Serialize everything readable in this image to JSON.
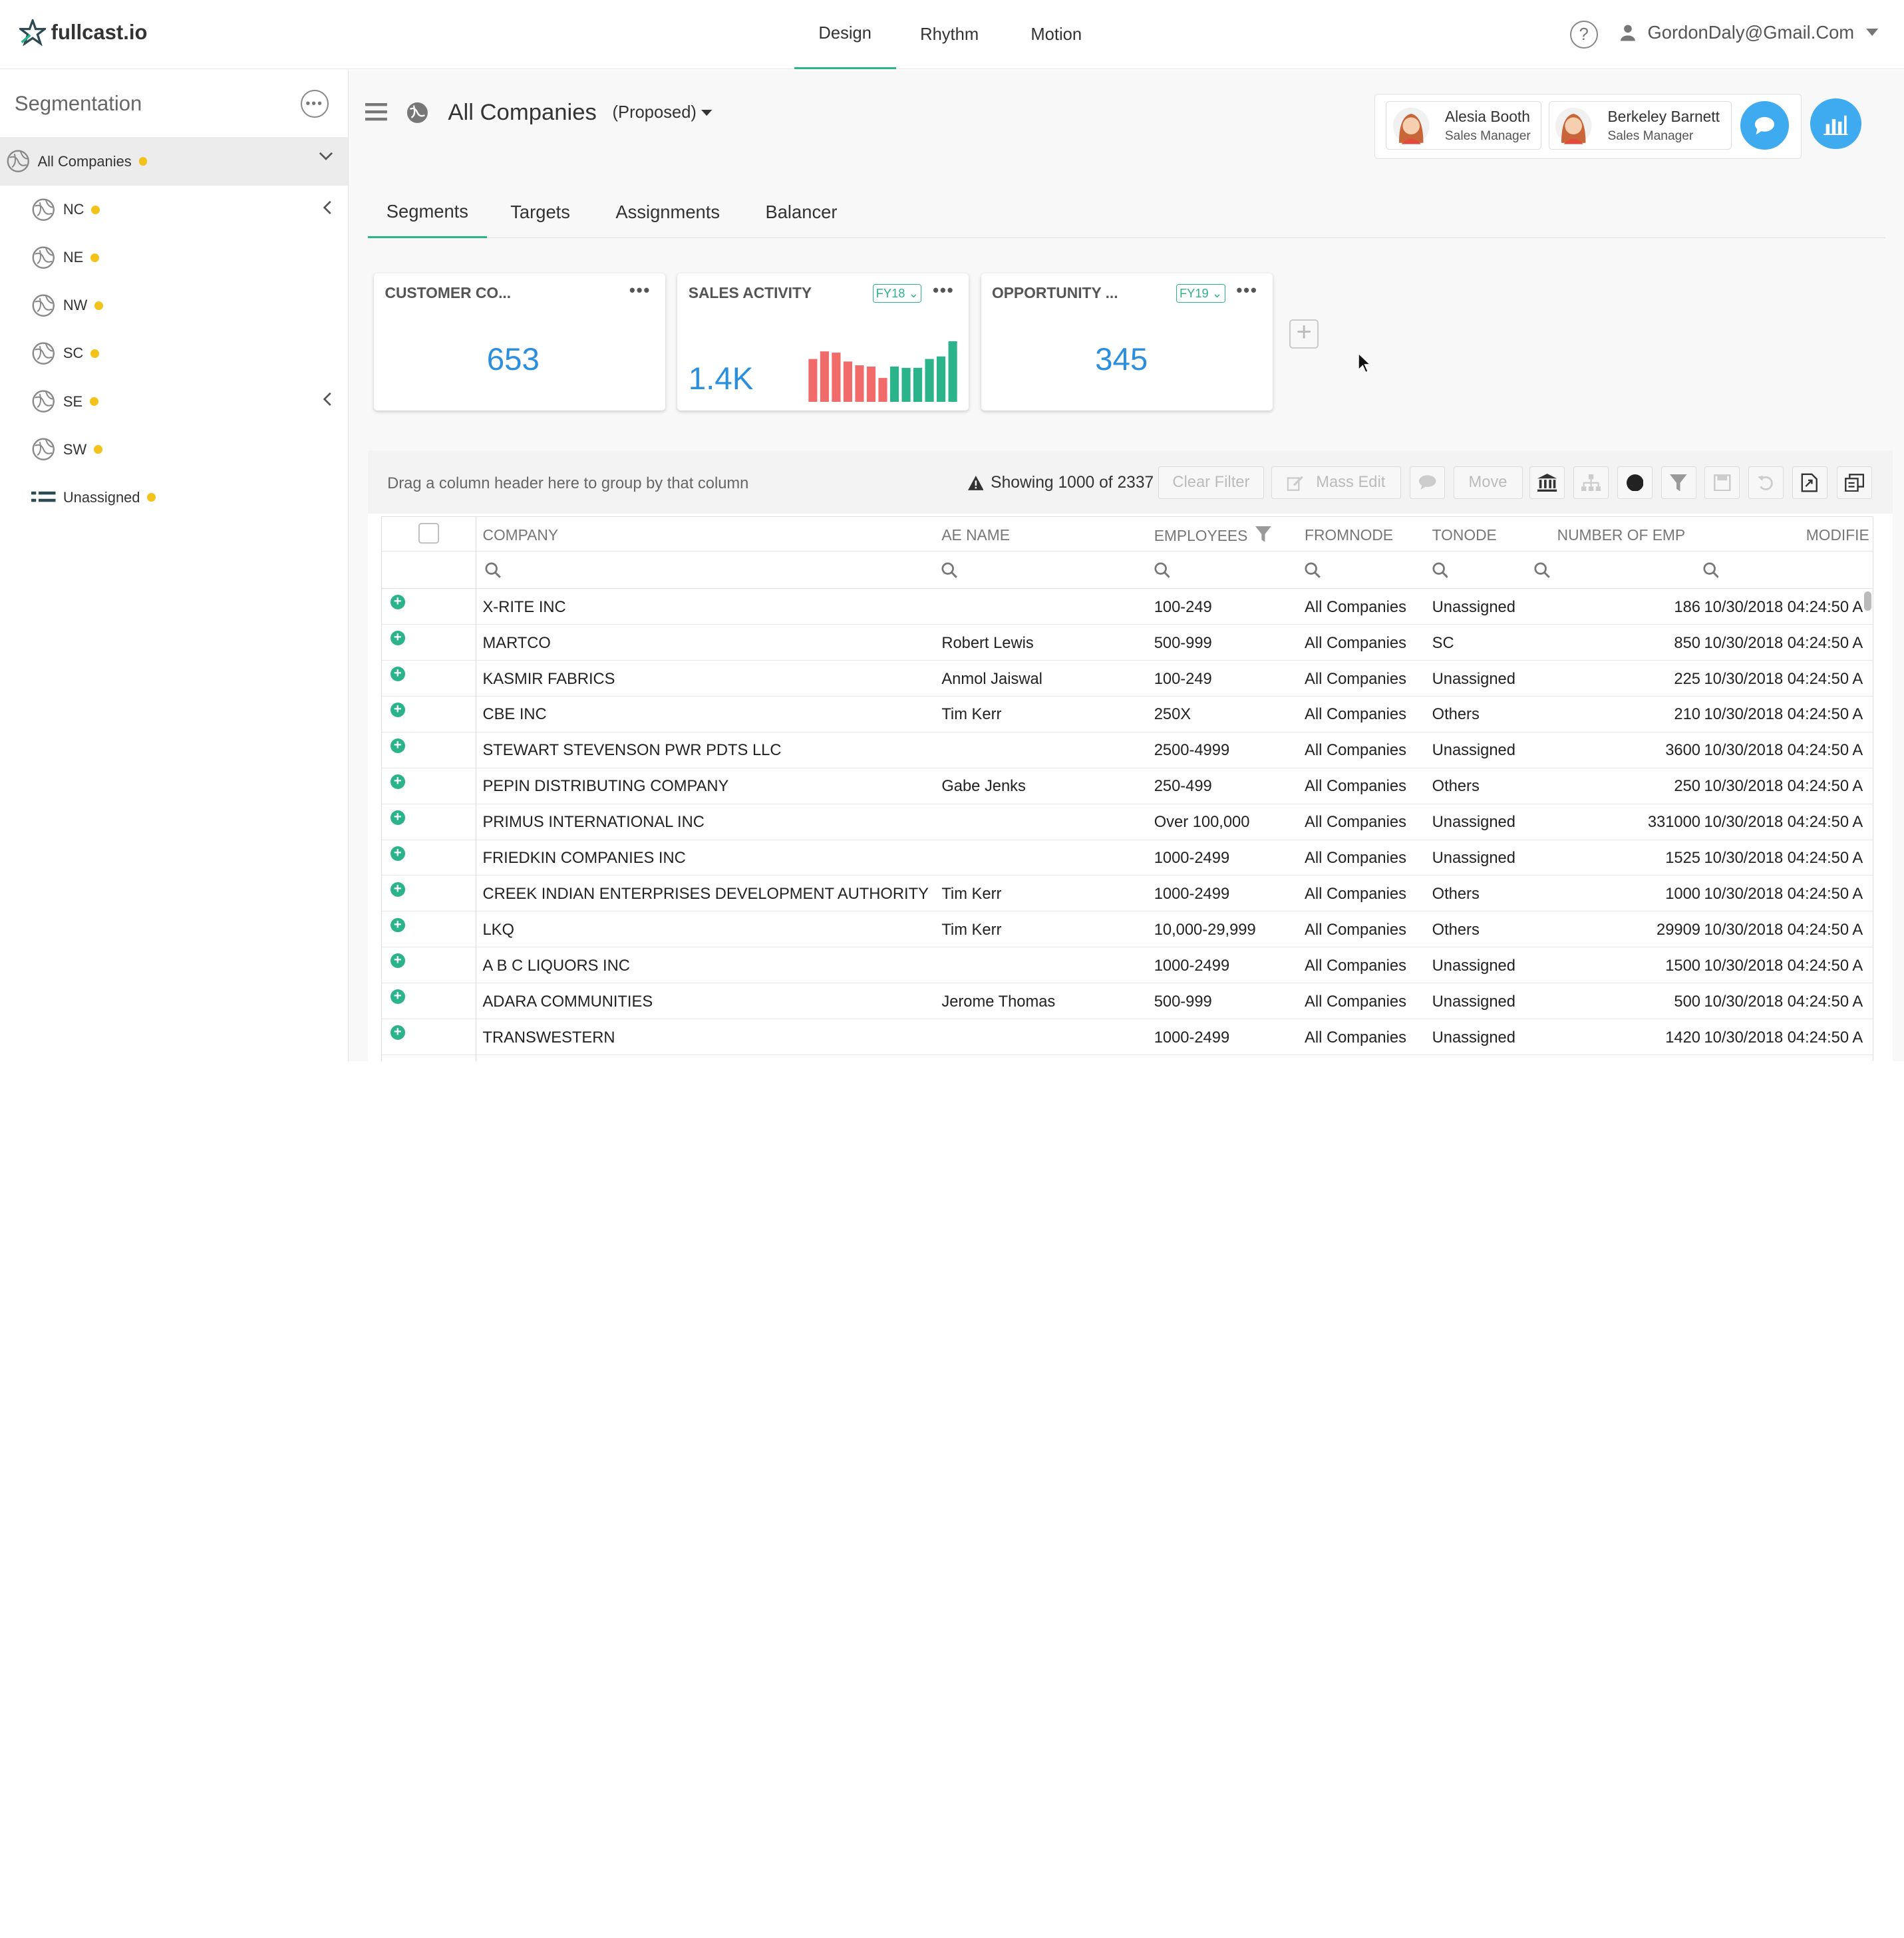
{
  "app": {
    "brand": "fullcast.io"
  },
  "topnav": {
    "items": [
      "Design",
      "Rhythm",
      "Motion"
    ],
    "active": "Design"
  },
  "user": {
    "email": "GordonDaly@Gmail.Com",
    "help": "?"
  },
  "sidebar": {
    "title": "Segmentation",
    "root": "All Companies",
    "items": [
      {
        "label": "NC",
        "expandable": true
      },
      {
        "label": "NE",
        "expandable": false
      },
      {
        "label": "NW",
        "expandable": false
      },
      {
        "label": "SC",
        "expandable": false
      },
      {
        "label": "SE",
        "expandable": true
      },
      {
        "label": "SW",
        "expandable": false
      }
    ],
    "unassigned": "Unassigned",
    "dot_color": "#f3c21b"
  },
  "header": {
    "title": "All Companies",
    "state": "(Proposed)"
  },
  "people": [
    {
      "name": "Alesia Booth",
      "role": "Sales Manager"
    },
    {
      "name": "Berkeley Barnett",
      "role": "Sales Manager"
    }
  ],
  "tabs": [
    "Segments",
    "Targets",
    "Assignments",
    "Balancer"
  ],
  "cards": {
    "customer": {
      "title": "CUSTOMER CO...",
      "value": "653"
    },
    "sales": {
      "title": "SALES ACTIVITY",
      "fy": "FY18",
      "value": "1.4K"
    },
    "opportunity": {
      "title": "OPPORTUNITY ...",
      "fy": "FY19",
      "value": "345"
    }
  },
  "chart_data": {
    "type": "bar",
    "title": "SALES ACTIVITY",
    "values": [
      34,
      40,
      39,
      32,
      29,
      28,
      19,
      28,
      27,
      27,
      34,
      36,
      48
    ],
    "colors": [
      "#f26b6b",
      "#f26b6b",
      "#f26b6b",
      "#f26b6b",
      "#f26b6b",
      "#f26b6b",
      "#f26b6b",
      "#2bb38a",
      "#2bb38a",
      "#2bb38a",
      "#2bb38a",
      "#2bb38a",
      "#2bb38a"
    ]
  },
  "toolbar": {
    "drag_hint": "Drag a column header here to group by that column",
    "showing": "Showing 1000 of 2337",
    "clear_filter": "Clear Filter",
    "mass_edit": "Mass Edit",
    "move": "Move"
  },
  "grid": {
    "columns": [
      "COMPANY",
      "AE NAME",
      "EMPLOYEES",
      "FROMNODE",
      "TONODE",
      "NUMBER OF EMP",
      "MODIFIE"
    ],
    "rows": [
      [
        "X-RITE INC",
        "",
        "100-249",
        "All Companies",
        "Unassigned",
        "186",
        "10/30/2018 04:24:50 A"
      ],
      [
        "MARTCO",
        "Robert Lewis",
        "500-999",
        "All Companies",
        "SC",
        "850",
        "10/30/2018 04:24:50 A"
      ],
      [
        "KASMIR FABRICS",
        "Anmol Jaiswal",
        "100-249",
        "All Companies",
        "Unassigned",
        "225",
        "10/30/2018 04:24:50 A"
      ],
      [
        "CBE INC",
        "Tim Kerr",
        "250X",
        "All Companies",
        "Others",
        "210",
        "10/30/2018 04:24:50 A"
      ],
      [
        "STEWART STEVENSON PWR PDTS LLC",
        "",
        "2500-4999",
        "All Companies",
        "Unassigned",
        "3600",
        "10/30/2018 04:24:50 A"
      ],
      [
        "PEPIN DISTRIBUTING COMPANY",
        "Gabe Jenks",
        "250-499",
        "All Companies",
        "Others",
        "250",
        "10/30/2018 04:24:50 A"
      ],
      [
        "PRIMUS INTERNATIONAL INC",
        "",
        "Over 100,000",
        "All Companies",
        "Unassigned",
        "331000",
        "10/30/2018 04:24:50 A"
      ],
      [
        "FRIEDKIN COMPANIES INC",
        "",
        "1000-2499",
        "All Companies",
        "Unassigned",
        "1525",
        "10/30/2018 04:24:50 A"
      ],
      [
        "CREEK INDIAN ENTERPRISES DEVELOPMENT AUTHORITY",
        "Tim Kerr",
        "1000-2499",
        "All Companies",
        "Others",
        "1000",
        "10/30/2018 04:24:50 A"
      ],
      [
        "LKQ",
        "Tim Kerr",
        "10,000-29,999",
        "All Companies",
        "Others",
        "29909",
        "10/30/2018 04:24:50 A"
      ],
      [
        "A B C LIQUORS INC",
        "",
        "1000-2499",
        "All Companies",
        "Unassigned",
        "1500",
        "10/30/2018 04:24:50 A"
      ],
      [
        "ADARA COMMUNITIES",
        "Jerome Thomas",
        "500-999",
        "All Companies",
        "Unassigned",
        "500",
        "10/30/2018 04:24:50 A"
      ],
      [
        "TRANSWESTERN",
        "",
        "1000-2499",
        "All Companies",
        "Unassigned",
        "1420",
        "10/30/2018 04:24:50 A"
      ]
    ]
  },
  "colors": {
    "accent": "#2bb38a",
    "value_blue": "#2b8fe0",
    "button_blue": "#3eaaf0"
  }
}
